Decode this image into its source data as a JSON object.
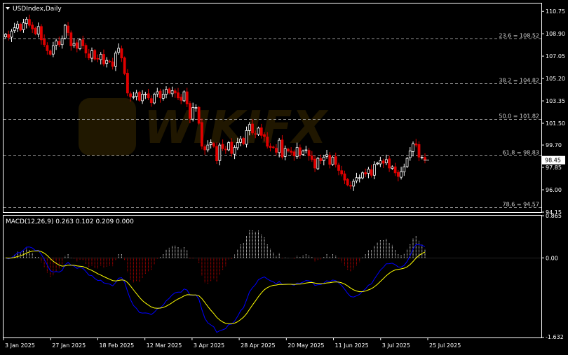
{
  "symbol_label": "USDIndex,Daily",
  "macd_label": "MACD(12,26,9) 0.263 0.102 0.209 0.000",
  "colors": {
    "background": "#000000",
    "frame": "#ffffff",
    "up_candle": "#ffffff",
    "down_candle": "#e00000",
    "fib_line": "#9a9a9a",
    "macd_line": "#0000ff",
    "signal_line": "#ffff00",
    "hist_pos": "#ffffff",
    "hist_neg": "#e00000",
    "watermark": "#3a2a00",
    "current_price_bg": "#ffffff"
  },
  "watermark": {
    "text": "WIKIFX",
    "icon": "wikifx-logo-icon"
  },
  "chart_data": [
    {
      "type": "candlestick",
      "title": "USDIndex,Daily",
      "ylim": [
        94.15,
        111.4
      ],
      "y_ticks": [
        "110.75",
        "108.90",
        "107.05",
        "105.20",
        "103.35",
        "101.50",
        "99.70",
        "97.85",
        "96.00",
        "94.15"
      ],
      "current_price": "98.45",
      "fib_levels": [
        {
          "label": "23.6 = 108.52",
          "value": 108.52
        },
        {
          "label": "38.2 = 104.82",
          "value": 104.82
        },
        {
          "label": "50.0 = 101.82",
          "value": 101.82
        },
        {
          "label": "61.8 = 98.83",
          "value": 98.83
        },
        {
          "label": "78.6 = 94.57",
          "value": 94.57
        }
      ],
      "x_labels": [
        "3 Jan 2025",
        "27 Jan 2025",
        "18 Feb 2025",
        "12 Mar 2025",
        "3 Apr 2025",
        "28 Apr 2025",
        "20 May 2025",
        "11 Jun 2025",
        "3 Jul 2025",
        "25 Jul 2025"
      ],
      "closes": [
        108.85,
        108.6,
        109.1,
        109.4,
        109.7,
        109.2,
        109.8,
        110.1,
        109.6,
        109.3,
        108.9,
        109.5,
        108.4,
        108.0,
        107.5,
        107.2,
        107.9,
        108.3,
        108.0,
        108.5,
        109.6,
        109.0,
        107.9,
        108.1,
        107.7,
        108.4,
        107.9,
        107.3,
        106.9,
        107.5,
        106.8,
        106.8,
        107.2,
        106.4,
        106.7,
        106.6,
        106.2,
        107.3,
        107.7,
        106.9,
        105.6,
        104.0,
        103.7,
        103.7,
        104.0,
        103.4,
        103.9,
        103.9,
        103.6,
        103.2,
        103.9,
        104.1,
        103.6,
        103.9,
        104.3,
        104.0,
        104.2,
        104.0,
        103.6,
        103.4,
        104.1,
        103.1,
        101.9,
        102.8,
        102.8,
        101.5,
        99.6,
        99.3,
        99.7,
        99.9,
        99.6,
        98.4,
        99.7,
        99.4,
        99.3,
        99.9,
        99.0,
        99.5,
        99.9,
        100.2,
        99.8,
        100.9,
        101.4,
        100.7,
        100.6,
        101.1,
        100.5,
        100.4,
        99.6,
        99.5,
        99.5,
        99.1,
        100.1,
        98.7,
        99.4,
        99.2,
        99.1,
        98.8,
        99.5,
        98.9,
        99.2,
        99.3,
        98.8,
        98.5,
        97.8,
        98.6,
        98.4,
        98.7,
        98.9,
        98.1,
        98.7,
        98.1,
        97.6,
        97.3,
        96.8,
        96.4,
        96.3,
        96.7,
        97.0,
        97.0,
        97.4,
        97.3,
        97.7,
        97.2,
        98.1,
        98.2,
        98.4,
        98.2,
        98.5,
        97.8,
        97.9,
        97.4,
        97.1,
        97.5,
        97.9,
        98.6,
        99.2,
        99.8,
        99.7,
        98.7,
        98.7,
        98.45
      ],
      "series_note": "",
      "grid": false
    },
    {
      "type": "macd",
      "title": "MACD(12,26,9) 0.263 0.102 0.209 0.000",
      "ylim": [
        -1.632,
        0.865
      ],
      "y_ticks": [
        "0.865",
        "0.00",
        "-1.632"
      ],
      "values": {
        "macd": 0.263,
        "signal": 0.102,
        "histogram": 0.209
      }
    }
  ]
}
